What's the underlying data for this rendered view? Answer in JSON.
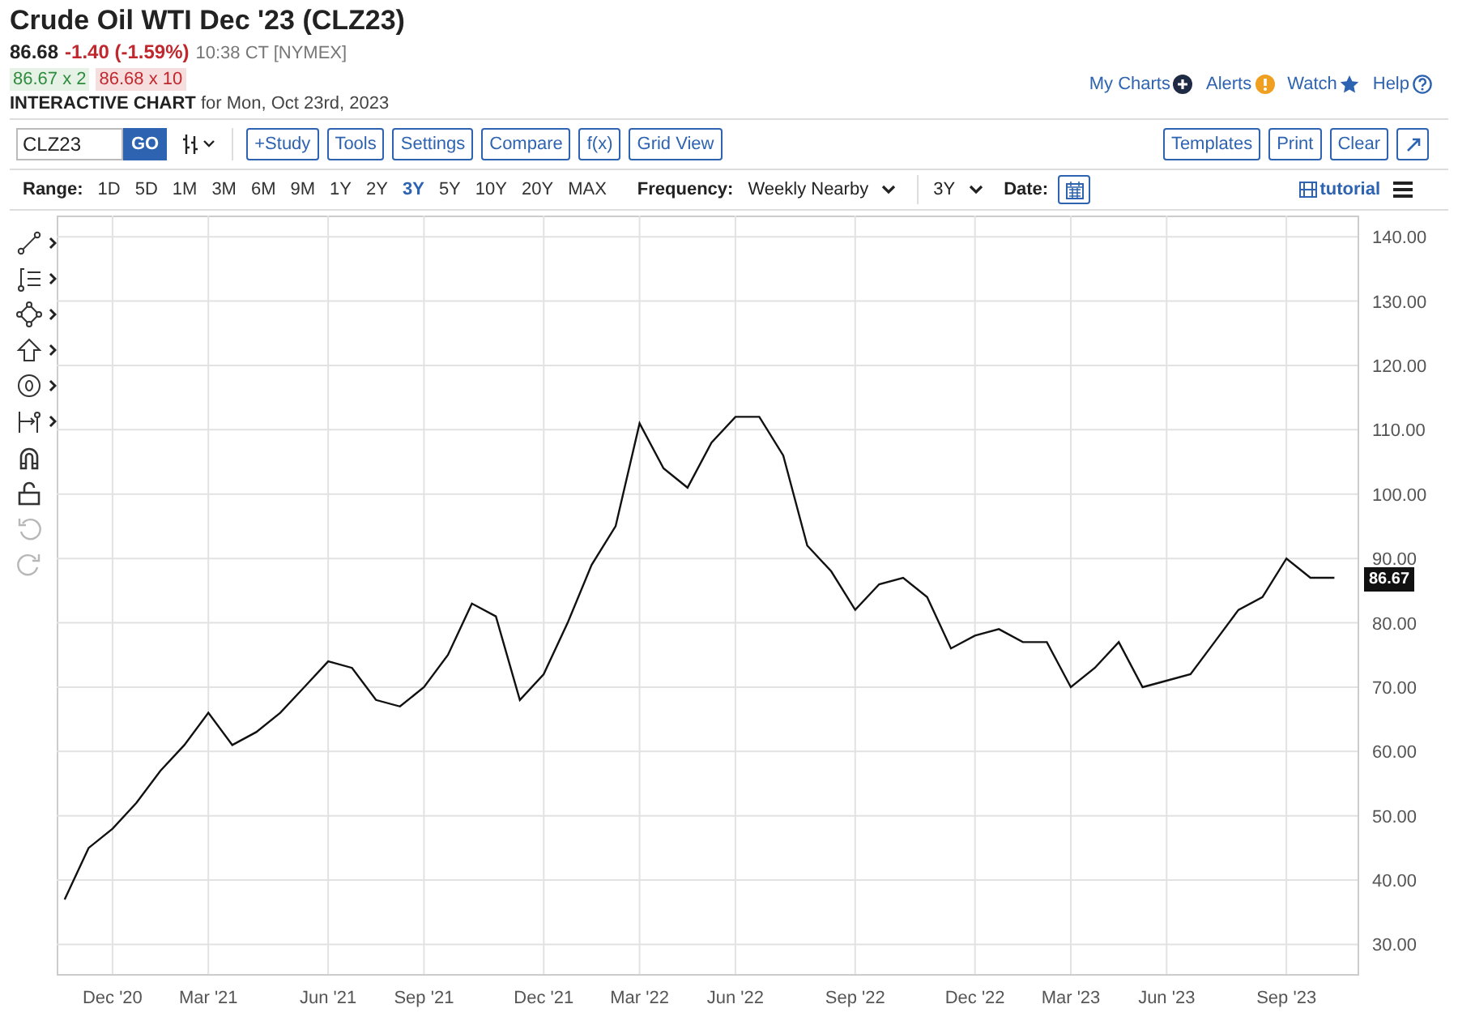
{
  "title": "Crude Oil WTI Dec '23 (CLZ23)",
  "quote": {
    "last": "86.68",
    "change": "-1.40 (-1.59%)",
    "negative": true,
    "time": "10:38 CT [NYMEX]"
  },
  "bid": "86.67 x 2",
  "ask": "86.68 x 10",
  "chart_heading": {
    "label": "INTERACTIVE CHART",
    "date": "for Mon, Oct 23rd, 2023"
  },
  "links": [
    {
      "label": "My Charts",
      "kind": "plus"
    },
    {
      "label": "Alerts",
      "kind": "alert"
    },
    {
      "label": "Watch",
      "kind": "star"
    },
    {
      "label": "Help",
      "kind": "help"
    }
  ],
  "toolbar": {
    "symbol": "CLZ23",
    "go": "GO",
    "buttons": [
      "+Study",
      "Tools",
      "Settings",
      "Compare",
      "f(x)",
      "Grid View"
    ],
    "right_buttons": [
      "Templates",
      "Print",
      "Clear"
    ]
  },
  "range": {
    "label": "Range:",
    "options": [
      {
        "label": "1D",
        "selected": false
      },
      {
        "label": "5D",
        "selected": false
      },
      {
        "label": "1M",
        "selected": false
      },
      {
        "label": "3M",
        "selected": false
      },
      {
        "label": "6M",
        "selected": false
      },
      {
        "label": "9M",
        "selected": false
      },
      {
        "label": "1Y",
        "selected": false
      },
      {
        "label": "2Y",
        "selected": false
      },
      {
        "label": "3Y",
        "selected": true
      },
      {
        "label": "5Y",
        "selected": false
      },
      {
        "label": "10Y",
        "selected": false
      },
      {
        "label": "20Y",
        "selected": false
      },
      {
        "label": "MAX",
        "selected": false
      }
    ]
  },
  "frequency": {
    "label": "Frequency:",
    "value": "Weekly Nearby"
  },
  "period": "3Y",
  "date_label": "Date:",
  "tutorial": "tutorial",
  "drawing_tools": [
    {
      "kind": "line",
      "expandable": true,
      "disabled": false
    },
    {
      "kind": "fib",
      "expandable": true,
      "disabled": false
    },
    {
      "kind": "shape",
      "expandable": true,
      "disabled": false
    },
    {
      "kind": "arrow",
      "expandable": true,
      "disabled": false
    },
    {
      "kind": "label",
      "expandable": true,
      "disabled": false
    },
    {
      "kind": "measure",
      "expandable": true,
      "disabled": false
    },
    {
      "kind": "magnet",
      "expandable": false,
      "disabled": false
    },
    {
      "kind": "lock",
      "expandable": false,
      "disabled": false
    },
    {
      "kind": "undo",
      "expandable": false,
      "disabled": true
    },
    {
      "kind": "redo",
      "expandable": false,
      "disabled": true
    }
  ],
  "price_tag": "86.67",
  "chart_data": {
    "type": "line",
    "categories": [
      null,
      null,
      "Dec '20",
      null,
      null,
      null,
      "Mar '21",
      null,
      null,
      null,
      null,
      "Jun '21",
      null,
      null,
      null,
      "Sep '21",
      null,
      null,
      null,
      null,
      "Dec '21",
      null,
      null,
      null,
      "Mar '22",
      null,
      null,
      null,
      "Jun '22",
      null,
      null,
      null,
      null,
      "Sep '22",
      null,
      null,
      null,
      null,
      "Dec '22",
      null,
      null,
      null,
      "Mar '23",
      null,
      null,
      null,
      "Jun '23",
      null,
      null,
      null,
      null,
      "Sep '23",
      null,
      null
    ],
    "values": [
      37,
      45,
      48,
      52,
      57,
      61,
      66,
      61,
      63,
      66,
      70,
      74,
      73,
      68,
      67,
      70,
      75,
      83,
      81,
      68,
      72,
      80,
      89,
      95,
      111,
      104,
      101,
      108,
      112,
      112,
      106,
      92,
      88,
      82,
      86,
      87,
      84,
      76,
      78,
      79,
      77,
      77,
      70,
      73,
      77,
      70,
      71,
      72,
      77,
      82,
      84,
      90,
      87,
      87
    ],
    "ylim": [
      25.4,
      143.3
    ],
    "grid": true,
    "yticks": [
      {
        "value": 30,
        "label": "30.00"
      },
      {
        "value": 40,
        "label": "40.00"
      },
      {
        "value": 50,
        "label": "50.00"
      },
      {
        "value": 60,
        "label": "60.00"
      },
      {
        "value": 70,
        "label": "70.00"
      },
      {
        "value": 80,
        "label": "80.00"
      },
      {
        "value": 90,
        "label": "90.00"
      },
      {
        "value": 100,
        "label": "100.00"
      },
      {
        "value": 110,
        "label": "110.00"
      },
      {
        "value": 120,
        "label": "120.00"
      },
      {
        "value": 130,
        "label": "130.00"
      },
      {
        "value": 140,
        "label": "140.00"
      }
    ]
  }
}
